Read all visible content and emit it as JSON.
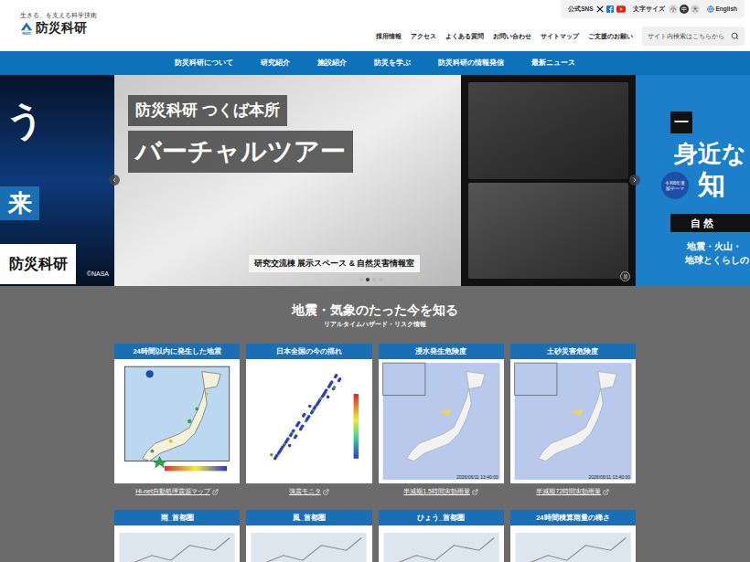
{
  "header": {
    "tagline": "生きる、を支える科学技術",
    "logo_mark": "NIED",
    "logo_text": "防災科研",
    "sns_label": "公式SNS",
    "font_size_label": "文字サイズ",
    "font_sizes": [
      {
        "label": "小",
        "selected": false
      },
      {
        "label": "中",
        "selected": true
      },
      {
        "label": "大",
        "selected": false
      }
    ],
    "language": "English",
    "links": [
      "採用情報",
      "アクセス",
      "よくある質問",
      "お問い合わせ",
      "サイトマップ",
      "ご支援のお願い"
    ],
    "search": {
      "placeholder": "サイト内検索はこちらから"
    }
  },
  "nav": [
    "防災科研について",
    "研究紹介",
    "施設紹介",
    "防災を学ぶ",
    "防災科研の情報発信",
    "最新ニュース"
  ],
  "hero": {
    "left": {
      "big": "う",
      "boxed": "来",
      "name": "防災科研",
      "credit": "©NASA"
    },
    "center": {
      "title_1": "防災科研 つくば本所",
      "title_2": "バーチャルツアー",
      "caption": "研究交流棟 展示スペース & 自然災害情報室"
    },
    "right": {
      "tag": "一",
      "big": "身近な",
      "badge": "令和6年度版テーマ",
      "big_2": "知",
      "strip": "自 然",
      "line_1": "地震・火山・",
      "line_2": "地球とくらしの"
    },
    "dots": [
      {
        "selected": false
      },
      {
        "selected": true
      },
      {
        "selected": false
      },
      {
        "selected": false
      }
    ]
  },
  "realtime": {
    "title": "地震・気象のたった今を知る",
    "subtitle": "リアルタイムハザード・リスク情報",
    "cards": [
      {
        "title": "24時間以内に発生した地震",
        "kind": "epicenter",
        "link": "Hi-net自動処理震源マップ",
        "timestamp": ""
      },
      {
        "title": "日本全国の今の揺れ",
        "kind": "shaking",
        "link": "強震モニタ",
        "timestamp": ""
      },
      {
        "title": "浸水発生危険度",
        "kind": "rain",
        "link": "半減期1.5時間実効雨量",
        "timestamp": "2026/06/11 13:40:00"
      },
      {
        "title": "土砂災害危険度",
        "kind": "rain",
        "link": "半減期72時間実効雨量",
        "timestamp": "2026/06/11 13:40:00"
      },
      {
        "title": "雨_首都圏",
        "kind": "kanto",
        "link": "",
        "timestamp": ""
      },
      {
        "title": "風_首都圏",
        "kind": "kanto",
        "link": "",
        "timestamp": ""
      },
      {
        "title": "ひょう_首都圏",
        "kind": "kanto",
        "link": "",
        "timestamp": ""
      },
      {
        "title": "24時間積算雨量の稀さ",
        "kind": "kanto",
        "link": "",
        "timestamp": ""
      }
    ]
  }
}
